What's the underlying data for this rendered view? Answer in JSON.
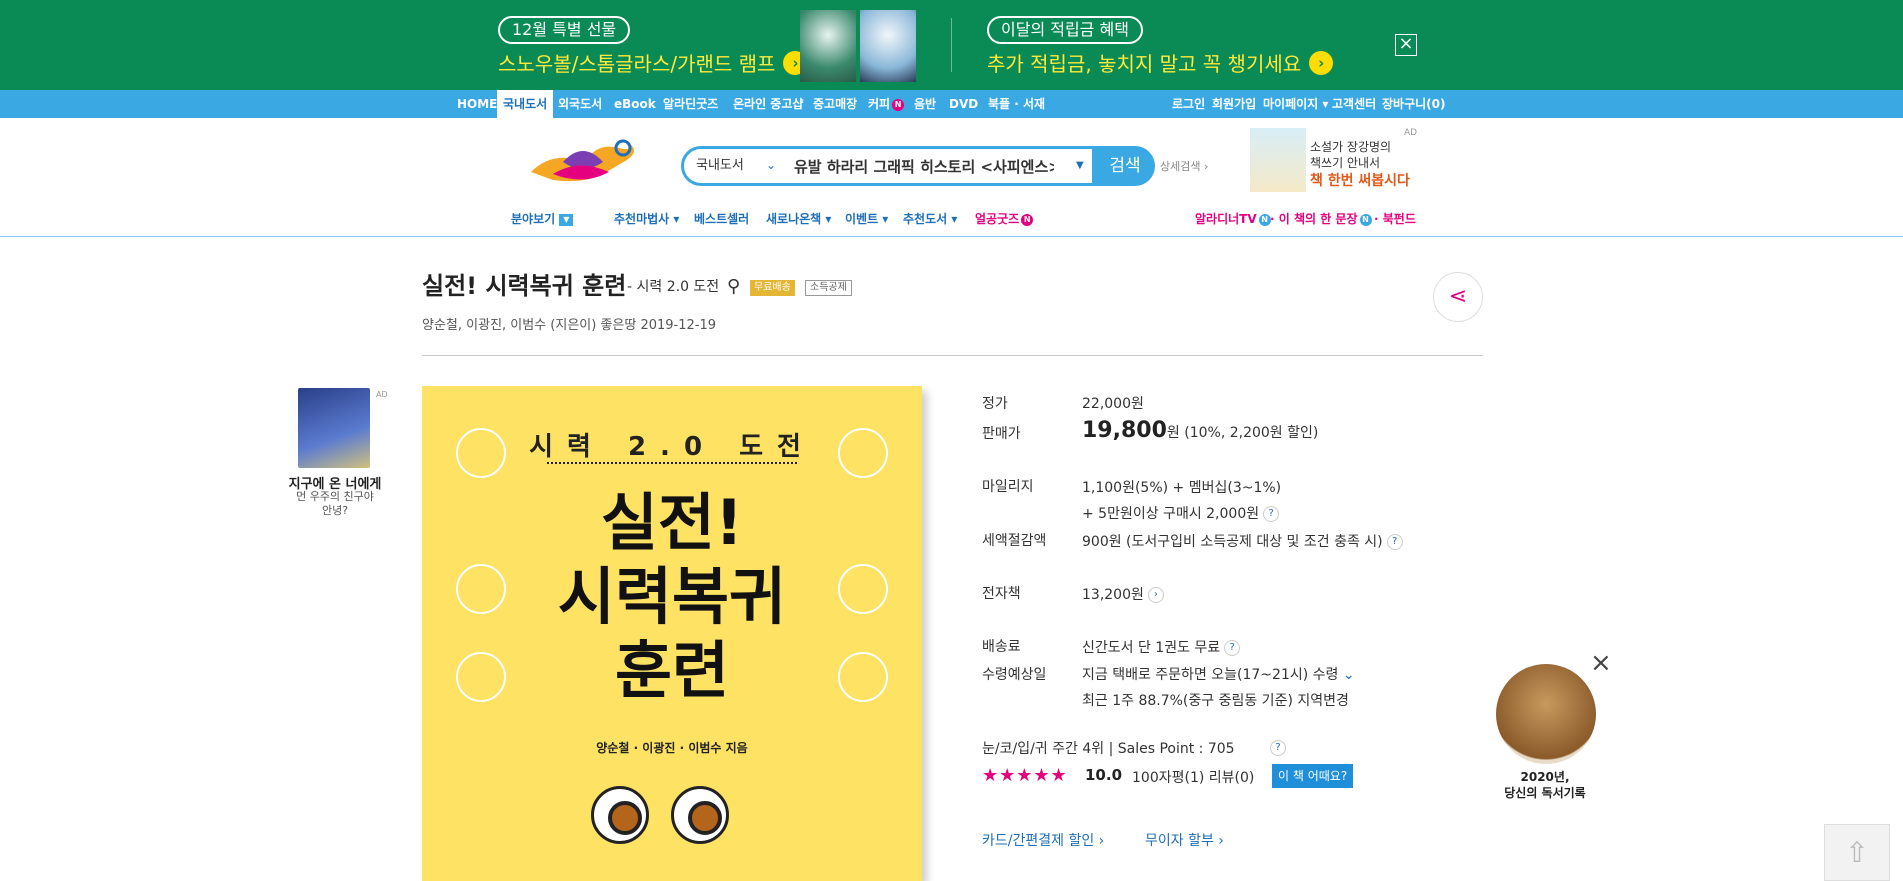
{
  "banner": {
    "left_pill": "12월 특별 선물",
    "left_text": "스노우볼/스톰글라스/가랜드 램프",
    "right_pill": "이달의 적립금 혜택",
    "right_text": "추가 적립금, 놓치지 말고 꼭 챙기세요",
    "close_icon": "close-icon"
  },
  "nav": {
    "items": [
      "HOME",
      "국내도서",
      "외국도서",
      "eBook",
      "알라딘굿즈",
      "온라인 중고샵",
      "중고매장",
      "커피",
      "음반",
      "DVD",
      "북플 · 서재"
    ],
    "active": "국내도서",
    "right_items": [
      "로그인",
      "회원가입",
      "마이페이지 ▾",
      "고객센터",
      "장바구니(0)"
    ]
  },
  "search": {
    "category": "국내도서",
    "value": "유발 하라리 그래픽 히스토리 <사피엔스>",
    "button": "검색",
    "detail": "상세검색 ›"
  },
  "header_ad": {
    "line1": "소설가 장강명의",
    "line2": "책쓰기 안내서",
    "line3": "책 한번 써봅시다",
    "tag": "AD"
  },
  "submenu": {
    "category": "분야보기",
    "items": [
      "추천마법사 ▾",
      "베스트셀러",
      "새로나온책 ▾",
      "이벤트 ▾",
      "추천도서 ▾",
      "얼공굿즈"
    ],
    "right_items": [
      "알라디너TV",
      "· 이 책의 한 문장",
      "· 북펀드"
    ]
  },
  "book": {
    "title": "실전! 시력복귀 훈련",
    "subtitle": "- 시력 2.0 도전",
    "tag_free": "무료배송",
    "tag_tax": "소득공제",
    "authors": "양순철,  이광진,  이범수 (지은이)   좋은땅   2019-12-19"
  },
  "left_ad": {
    "tag": "AD",
    "title": "지구에 온 너에게",
    "sub1": "먼 우주의 친구야",
    "sub2": "안녕?"
  },
  "cover": {
    "top": "시력 2.0 도전",
    "line1": "실전!",
    "line2": "시력복귀",
    "line3": "훈련",
    "authors": "양순철 · 이광진 · 이범수 지음"
  },
  "price": {
    "list_label": "정가",
    "list_value": "22,000원",
    "sale_label": "판매가",
    "sale_value": "19,800",
    "sale_unit": "원",
    "sale_discount": "(10%, 2,200원 할인)",
    "mileage_label": "마일리지",
    "mileage_line1": "1,100원(5%) +  멤버십(3~1%)",
    "mileage_line2": "+ 5만원이상 구매시 2,000원",
    "tax_label": "세액절감액",
    "tax_value": "900원 (도서구입비 소득공제 대상 및 조건 충족 시)",
    "ebook_label": "전자책",
    "ebook_value": "13,200원",
    "ship_label": "배송료",
    "ship_value": "신간도서 단 1권도 무료",
    "eta_label": "수령예상일",
    "eta_line1": "지금  택배로 주문하면 오늘(17~21시) 수령",
    "eta_line2": "최근 1주 88.7%(중구 중림동 기준) 지역변경",
    "rank": "눈/코/입/귀 주간 4위  |  Sales Point : 705",
    "stars": "★★★★★",
    "rating": "10.0",
    "reviews": "100자평(1)   리뷰(0)",
    "how_button": "이 책 어때요?",
    "card_link": "카드/간편결제 할인 ›",
    "installment_link": "무이자 할부 ›"
  },
  "floating": {
    "text1": "2020년,",
    "text2": "당신의 독서기록"
  },
  "colors": {
    "banner_green": "#0a8a55",
    "nav_blue": "#3aa9e3",
    "accent_pink": "#e5007f"
  }
}
